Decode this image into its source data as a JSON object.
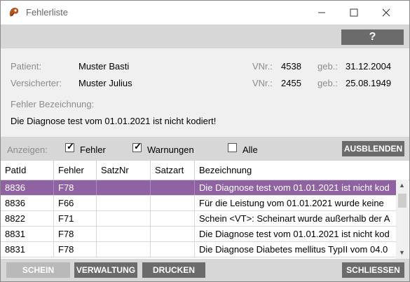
{
  "window": {
    "title": "Fehlerliste"
  },
  "toolbar": {
    "help_label": "?"
  },
  "patient": {
    "patient_label": "Patient:",
    "patient_name": "Muster Basti",
    "insured_label": "Versicherter:",
    "insured_name": "Muster Julius",
    "vnr_label": "VNr.:",
    "patient_vnr": "4538",
    "insured_vnr": "2455",
    "dob_label": "geb.:",
    "patient_dob": "31.12.2004",
    "insured_dob": "25.08.1949",
    "error_label": "Fehler Bezeichnung:",
    "error_text": "Die Diagnose test vom 01.01.2021 ist nicht kodiert!"
  },
  "filter": {
    "show_label": "Anzeigen:",
    "options": [
      {
        "label": "Fehler",
        "checked": true
      },
      {
        "label": "Warnungen",
        "checked": true
      },
      {
        "label": "Alle",
        "checked": false
      }
    ],
    "hide_button": "AUSBLENDEN"
  },
  "table": {
    "columns": [
      "PatId",
      "Fehler",
      "SatzNr",
      "Satzart",
      "Bezeichnung"
    ],
    "rows": [
      {
        "patid": "8836",
        "fehler": "F78",
        "satznr": "",
        "satzart": "",
        "bezeichnung": "Die Diagnose test vom 01.01.2021 ist nicht kod",
        "selected": true
      },
      {
        "patid": "8836",
        "fehler": "F66",
        "satznr": "",
        "satzart": "",
        "bezeichnung": "Für die Leistung vom 01.01.2021 wurde keine",
        "selected": false
      },
      {
        "patid": "8822",
        "fehler": "F71",
        "satznr": "",
        "satzart": "",
        "bezeichnung": "Schein <VT>: Scheinart wurde außerhalb der A",
        "selected": false
      },
      {
        "patid": "8831",
        "fehler": "F78",
        "satznr": "",
        "satzart": "",
        "bezeichnung": "Die Diagnose test vom 01.01.2021 ist nicht kod",
        "selected": false
      },
      {
        "patid": "8831",
        "fehler": "F78",
        "satznr": "",
        "satzart": "",
        "bezeichnung": "Die Diagnose Diabetes mellitus TypII vom 04.0",
        "selected": false
      }
    ]
  },
  "buttons": {
    "schein": "SCHEIN",
    "verwaltung": "VERWALTUNG",
    "drucken": "DRUCKEN",
    "schliessen": "SCHLIESSEN"
  },
  "colors": {
    "selection": "#8f63a2",
    "button_dark": "#6b6b6b",
    "button_disabled": "#b9b9b9",
    "bar_gray": "#d7d7d7"
  }
}
